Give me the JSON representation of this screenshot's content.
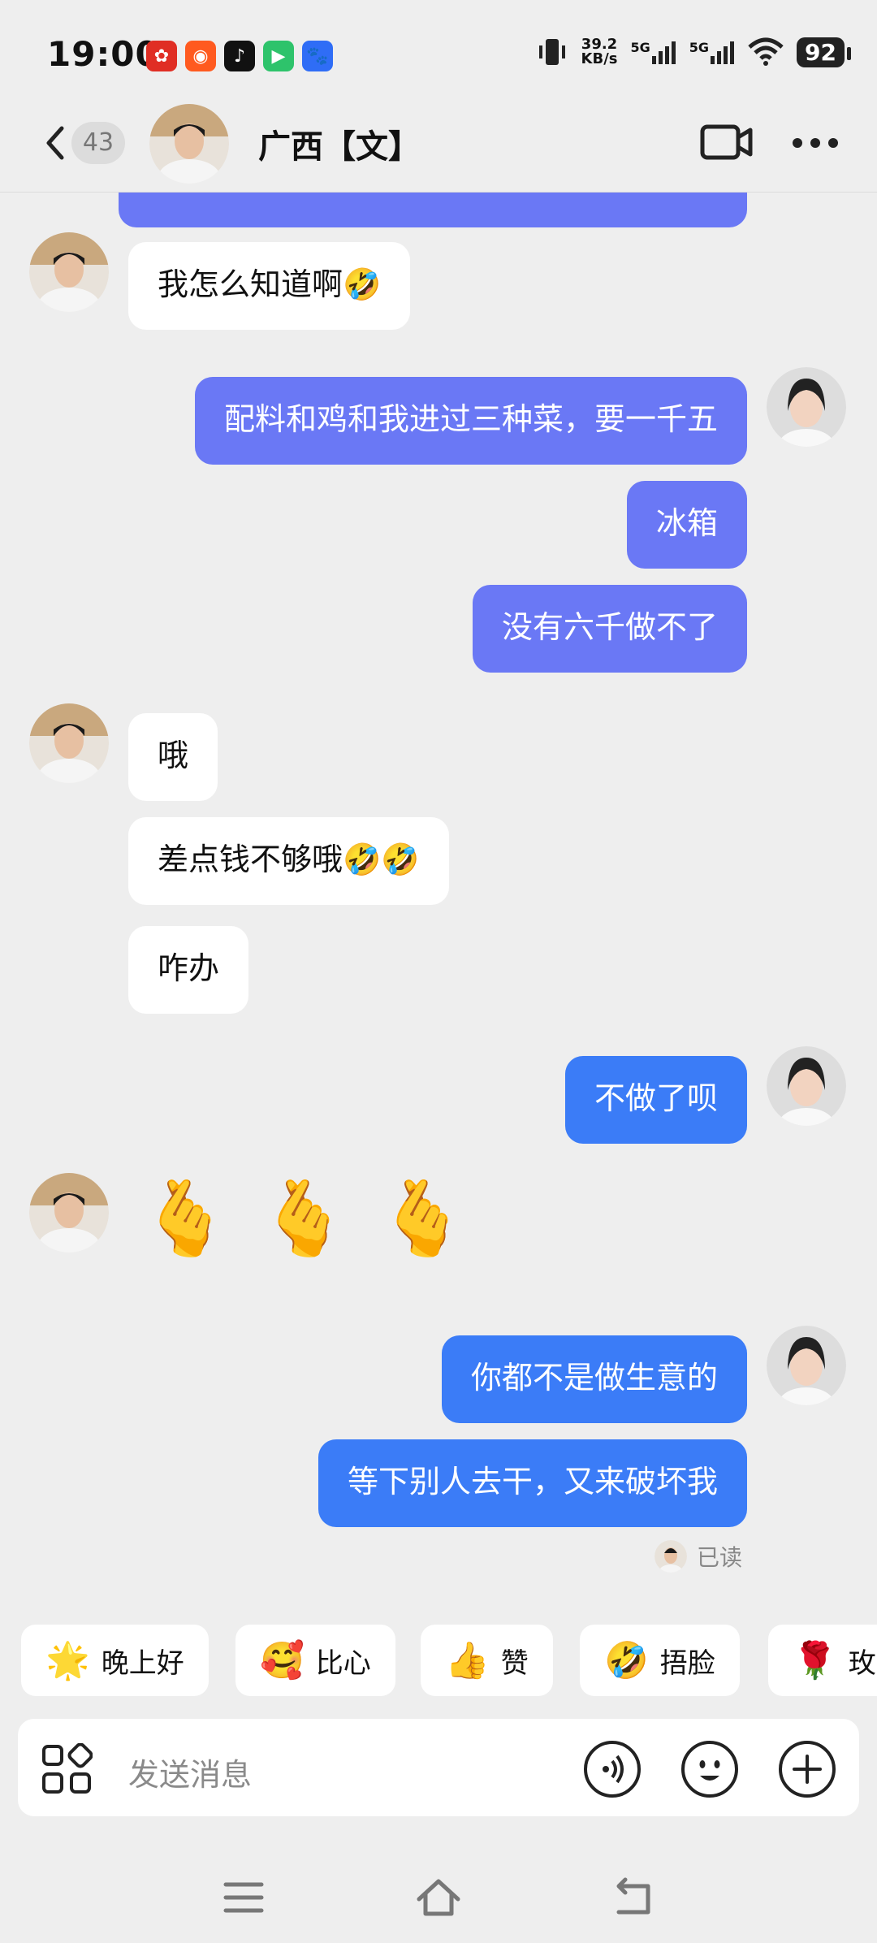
{
  "status_bar": {
    "time": "19:00",
    "net_speed_value": "39.2",
    "net_speed_unit": "KB/s",
    "signal_1": "5G",
    "signal_2": "5G",
    "battery": "92",
    "app_icons": [
      "pinduoduo-icon",
      "kuaishou-icon",
      "tiktok-icon",
      "video-app-icon",
      "baidu-icon"
    ]
  },
  "header": {
    "unread_count": "43",
    "contact_name": "广西【文】"
  },
  "messages": [
    {
      "side": "in",
      "text": "我怎么知道啊🤣"
    },
    {
      "side": "out",
      "text": "配料和鸡和我进过三种菜，要一千五"
    },
    {
      "side": "out",
      "text": "冰箱"
    },
    {
      "side": "out",
      "text": "没有六千做不了"
    },
    {
      "side": "in",
      "text": "哦"
    },
    {
      "side": "in",
      "text": "差点钱不够哦🤣🤣"
    },
    {
      "side": "in",
      "text": "咋办"
    },
    {
      "side": "out",
      "text": "不做了呗"
    },
    {
      "side": "in",
      "text": "🫰🫰🫰"
    },
    {
      "side": "out",
      "text": "你都不是做生意的"
    },
    {
      "side": "out",
      "text": "等下别人去干，又来破坏我"
    }
  ],
  "read_status": "已读",
  "quick_replies": [
    {
      "icon": "🌟",
      "label": "晚上好"
    },
    {
      "icon": "🥰",
      "label": "比心"
    },
    {
      "icon": "👍",
      "label": "赞"
    },
    {
      "icon": "🤣",
      "label": "捂脸"
    },
    {
      "icon": "🌹",
      "label": "玫"
    }
  ],
  "input": {
    "placeholder": "发送消息"
  },
  "colors": {
    "outgoing_purple": "#6a78f5",
    "outgoing_blue": "#3b7cf7",
    "incoming": "#ffffff",
    "background": "#eeeeee"
  }
}
